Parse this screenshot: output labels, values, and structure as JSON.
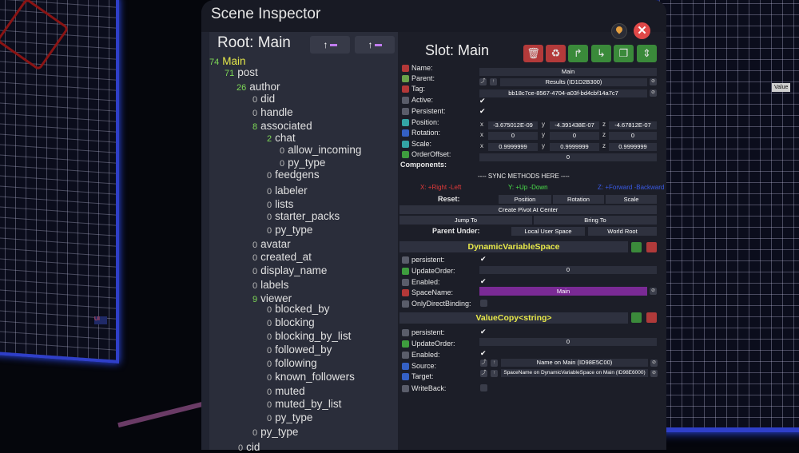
{
  "window": {
    "title": "Scene Inspector"
  },
  "hierarchy": {
    "root_label": "Root: Main",
    "btn_expand": "↑",
    "btn_collapse": "↑",
    "nodes": [
      {
        "count": "74",
        "label": "Main",
        "highlight": true
      },
      {
        "count": "71",
        "label": "post"
      },
      {
        "count": "26",
        "label": "author"
      },
      {
        "count": "0",
        "label": "did"
      },
      {
        "count": "0",
        "label": "handle"
      },
      {
        "count": "8",
        "label": "associated"
      },
      {
        "count": "2",
        "label": "chat"
      },
      {
        "count": "0",
        "label": "allow_incoming"
      },
      {
        "count": "0",
        "label": "py_type"
      },
      {
        "count": "0",
        "label": "feedgens"
      },
      {
        "count": "0",
        "label": "labeler"
      },
      {
        "count": "0",
        "label": "lists"
      },
      {
        "count": "0",
        "label": "starter_packs"
      },
      {
        "count": "0",
        "label": "py_type"
      },
      {
        "count": "0",
        "label": "avatar"
      },
      {
        "count": "0",
        "label": "created_at"
      },
      {
        "count": "0",
        "label": "display_name"
      },
      {
        "count": "0",
        "label": "labels"
      },
      {
        "count": "9",
        "label": "viewer"
      },
      {
        "count": "0",
        "label": "blocked_by"
      },
      {
        "count": "0",
        "label": "blocking"
      },
      {
        "count": "0",
        "label": "blocking_by_list"
      },
      {
        "count": "0",
        "label": "followed_by"
      },
      {
        "count": "0",
        "label": "following"
      },
      {
        "count": "0",
        "label": "known_followers"
      },
      {
        "count": "0",
        "label": "muted"
      },
      {
        "count": "0",
        "label": "muted_by_list"
      },
      {
        "count": "0",
        "label": "py_type"
      },
      {
        "count": "0",
        "label": "py_type"
      },
      {
        "count": "0",
        "label": "cid"
      }
    ]
  },
  "slot": {
    "title": "Slot: Main",
    "labels": {
      "name": "Name:",
      "parent": "Parent:",
      "tag": "Tag:",
      "active": "Active:",
      "persistent": "Persistent:",
      "position": "Position:",
      "rotation": "Rotation:",
      "scale": "Scale:",
      "order_offset": "OrderOffset:",
      "components": "Components:"
    },
    "name": "Main",
    "parent": "Results (ID1D2B300)",
    "tag": "bb18c7ce-8567-4704-a03f-bd4cbf14a7c7",
    "axis_x": "x",
    "axis_y": "y",
    "axis_z": "z",
    "position": [
      "-3.675012E-09",
      "-4.391438E-07",
      "-4.67812E-07"
    ],
    "rotation": [
      "0",
      "0",
      "0"
    ],
    "scale": [
      "0.9999999",
      "0.9999999",
      "0.9999999"
    ],
    "order_offset": "0"
  },
  "sync": {
    "header": "---- SYNC METHODS HERE ----",
    "x_legend": "X: +Right -Left",
    "y_legend": "Y: +Up -Down",
    "z_legend": "Z: +Forward -Backward",
    "reset_label": "Reset:",
    "reset_position": "Position",
    "reset_rotation": "Rotation",
    "reset_scale": "Scale",
    "create_pivot": "Create Pivot At Center",
    "jump_to": "Jump To",
    "bring_to": "Bring To",
    "parent_under_label": "Parent Under:",
    "local_user_space": "Local User Space",
    "world_root": "World Root"
  },
  "components": [
    {
      "title": "DynamicVariableSpace",
      "labels": {
        "persistent": "persistent:",
        "update_order": "UpdateOrder:",
        "enabled": "Enabled:",
        "space_name": "SpaceName:",
        "only_direct": "OnlyDirectBinding:"
      },
      "update_order": "0",
      "space_name": "Main"
    },
    {
      "title": "ValueCopy<string>",
      "labels": {
        "persistent": "persistent:",
        "update_order": "UpdateOrder:",
        "enabled": "Enabled:",
        "source": "Source:",
        "target": "Target:",
        "write_back": "WriteBack:"
      },
      "update_order": "0",
      "source": "Name on Main (ID98E5C00)",
      "target": "SpaceName on DynamicVariableSpace on Main (ID98E6000)"
    }
  ],
  "scene": {
    "value_tag": "Value",
    "ui_label": "UI"
  },
  "colors": {
    "accent_yellow": "#e6e94a",
    "panel": "#212431",
    "close_red": "#e04848",
    "neon_blue": "#2f3fc9",
    "space_name_purple": "#7a2a95"
  }
}
